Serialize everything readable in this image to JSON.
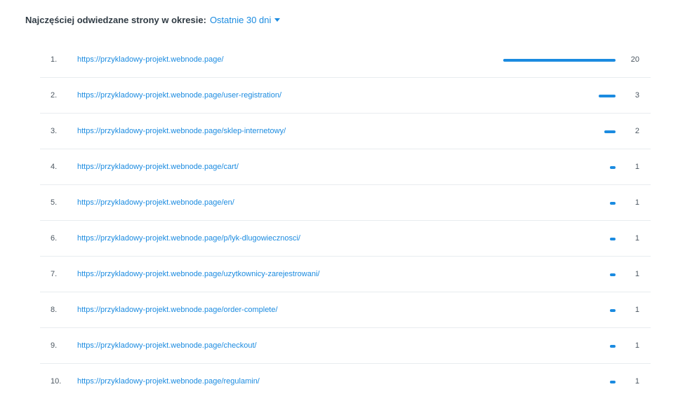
{
  "header": {
    "label": "Najczęściej odwiedzane strony w okresie:",
    "period": "Ostatnie 30 dni"
  },
  "colors": {
    "accent": "#1b8be0",
    "text": "#313c45",
    "divider": "#e8ecef"
  },
  "icons": {
    "dropdown": "caret-down-icon"
  },
  "pages": [
    {
      "rank": "1.",
      "url": "https://przykladowy-projekt.webnode.page/",
      "count": "20",
      "value": 20
    },
    {
      "rank": "2.",
      "url": "https://przykladowy-projekt.webnode.page/user-registration/",
      "count": "3",
      "value": 3
    },
    {
      "rank": "3.",
      "url": "https://przykladowy-projekt.webnode.page/sklep-internetowy/",
      "count": "2",
      "value": 2
    },
    {
      "rank": "4.",
      "url": "https://przykladowy-projekt.webnode.page/cart/",
      "count": "1",
      "value": 1
    },
    {
      "rank": "5.",
      "url": "https://przykladowy-projekt.webnode.page/en/",
      "count": "1",
      "value": 1
    },
    {
      "rank": "6.",
      "url": "https://przykladowy-projekt.webnode.page/p/lyk-dlugowiecznosci/",
      "count": "1",
      "value": 1
    },
    {
      "rank": "7.",
      "url": "https://przykladowy-projekt.webnode.page/uzytkownicy-zarejestrowani/",
      "count": "1",
      "value": 1
    },
    {
      "rank": "8.",
      "url": "https://przykladowy-projekt.webnode.page/order-complete/",
      "count": "1",
      "value": 1
    },
    {
      "rank": "9.",
      "url": "https://przykladowy-projekt.webnode.page/checkout/",
      "count": "1",
      "value": 1
    },
    {
      "rank": "10.",
      "url": "https://przykladowy-projekt.webnode.page/regulamin/",
      "count": "1",
      "value": 1
    }
  ]
}
